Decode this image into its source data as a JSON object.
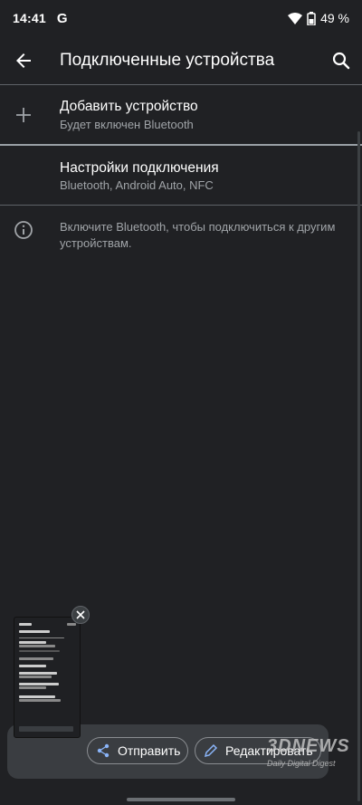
{
  "status_bar": {
    "time": "14:41",
    "g_letter": "G",
    "battery": "49 %"
  },
  "app_bar": {
    "title": "Подключенные устройства"
  },
  "items": [
    {
      "title": "Добавить устройство",
      "subtitle": "Будет включен Bluetooth",
      "icon": "plus-icon"
    },
    {
      "title": "Настройки подключения",
      "subtitle": "Bluetooth, Android Auto, NFC"
    }
  ],
  "info": {
    "text": "Включите Bluetooth, чтобы подключиться к другим устройствам.",
    "icon": "info-icon"
  },
  "screenshot_preview": {
    "share_label": "Отправить",
    "edit_label": "Редактировать"
  },
  "watermark": {
    "brand": "3DNEWS",
    "tagline": "Daily Digital Digest"
  },
  "colors": {
    "background": "#202124",
    "text_primary": "#ffffff",
    "text_secondary": "#a0a4a8",
    "divider": "#5f6368"
  }
}
